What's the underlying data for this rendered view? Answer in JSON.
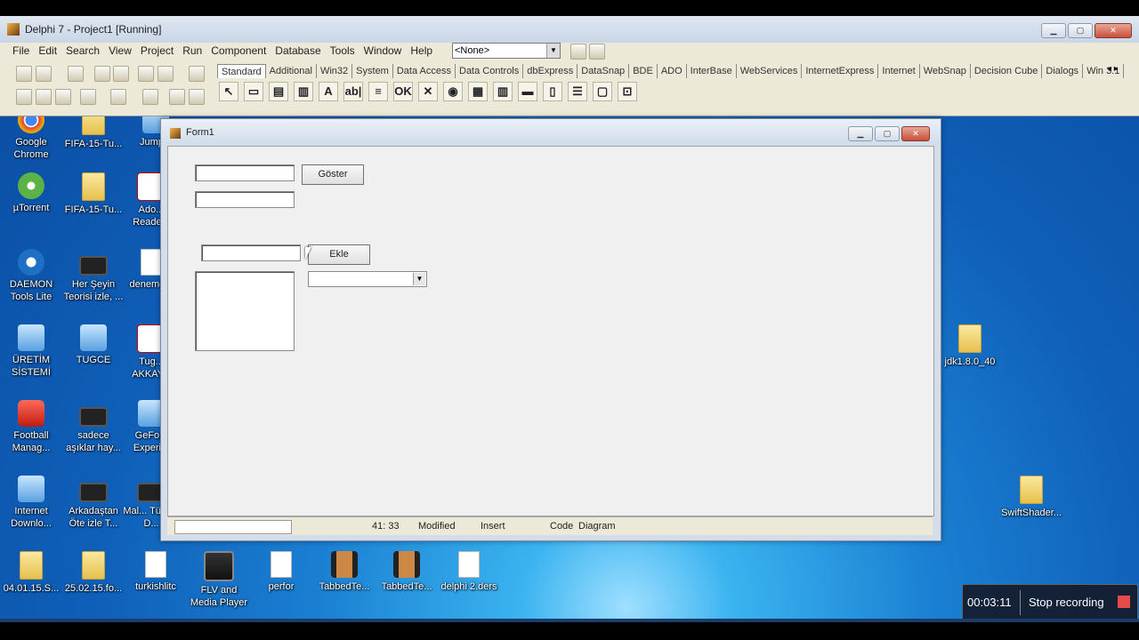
{
  "ide": {
    "title": "Delphi 7 - Project1 [Running]",
    "menu": [
      "File",
      "Edit",
      "Search",
      "View",
      "Project",
      "Run",
      "Component",
      "Database",
      "Tools",
      "Window",
      "Help"
    ],
    "combo_value": "<None>",
    "palette_tabs": [
      "Standard",
      "Additional",
      "Win32",
      "System",
      "Data Access",
      "Data Controls",
      "dbExpress",
      "DataSnap",
      "BDE",
      "ADO",
      "InterBase",
      "WebServices",
      "InternetExpress",
      "Internet",
      "WebSnap",
      "Decision Cube",
      "Dialogs",
      "Win 3.1"
    ],
    "palette_glyphs": [
      "↖",
      "▭",
      "▤",
      "▥",
      "A",
      "ab|",
      "≡",
      "OK",
      "✕",
      "◉",
      "▦",
      "▥",
      "▬",
      "▯",
      "☰",
      "▢",
      "⊡"
    ],
    "scroll_arrows": "◂ ▸"
  },
  "form": {
    "title": "Form1",
    "buttons": {
      "goster": "Göster",
      "ekle": "Ekle"
    },
    "edit1_value": "",
    "edit2_value": "",
    "edit3_value": "",
    "combo_value": ""
  },
  "editor_status": {
    "position": "41: 33",
    "modified": "Modified",
    "mode": "Insert",
    "tab_code": "Code",
    "tab_diagram": "Diagram"
  },
  "desktop_icons": [
    {
      "label": "Google Chrome",
      "icon": "chrome-icon"
    },
    {
      "label": "FIFA-15-Tu...",
      "icon": "folder-icon"
    },
    {
      "label": "Jump...",
      "icon": "app-icon"
    },
    {
      "label": "µTorrent",
      "icon": "utorrent-icon"
    },
    {
      "label": "FIFA-15-Tu...",
      "icon": "folder-icon"
    },
    {
      "label": "Ado... Reade...",
      "icon": "pdf-icon"
    },
    {
      "label": "DAEMON Tools Lite",
      "icon": "daemon-icon"
    },
    {
      "label": "Her Şeyin Teorisi izle, ...",
      "icon": "video-icon"
    },
    {
      "label": "deneme...",
      "icon": "doc-icon"
    },
    {
      "label": "ÜRETİM SİSTEMİ",
      "icon": "app-icon"
    },
    {
      "label": "TUGCE",
      "icon": "app-icon"
    },
    {
      "label": "Tug... AKKAY...",
      "icon": "pdf-icon"
    },
    {
      "label": "Football Manag...",
      "icon": "football-icon"
    },
    {
      "label": "sadece aşıklar hay...",
      "icon": "video-icon"
    },
    {
      "label": "GeFo... Experi...",
      "icon": "app-icon"
    },
    {
      "label": "Internet Downlo...",
      "icon": "app-icon"
    },
    {
      "label": "Arkadaştan Öte izle T...",
      "icon": "video-icon"
    },
    {
      "label": "Mal... Türkçe D...",
      "icon": "video-icon"
    },
    {
      "label": "04.01.15.S...",
      "icon": "folder-icon"
    },
    {
      "label": "25.02.15.fo...",
      "icon": "folder-icon"
    },
    {
      "label": "turkishlitc",
      "icon": "doc-icon"
    },
    {
      "label": "FLV and Media Player",
      "icon": "flv-icon"
    },
    {
      "label": "perfor",
      "icon": "doc-icon"
    },
    {
      "label": "TabbedTe...",
      "icon": "film-icon"
    },
    {
      "label": "TabbedTe...",
      "icon": "film-icon"
    },
    {
      "label": "delphi 2.ders",
      "icon": "doc-icon"
    },
    {
      "label": "jdk1.8.0_40",
      "icon": "folder-icon"
    },
    {
      "label": "SwiftShader...",
      "icon": "folder-icon"
    }
  ],
  "recording": {
    "time": "00:03:11",
    "stop_label": "Stop recording"
  }
}
